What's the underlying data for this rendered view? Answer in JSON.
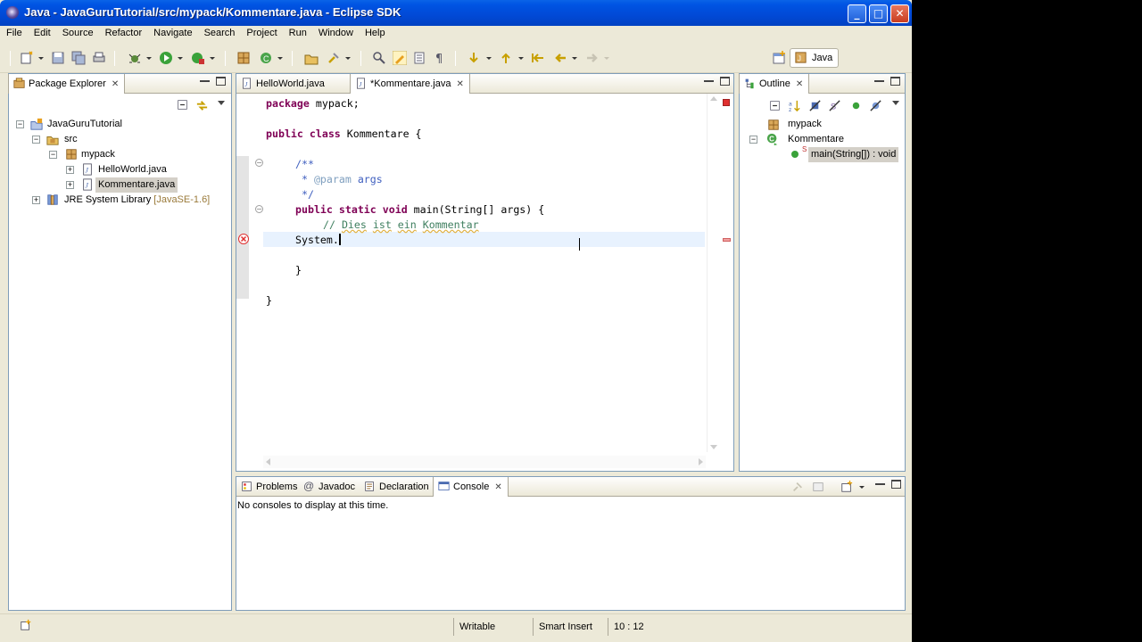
{
  "window": {
    "title": "Java - JavaGuruTutorial/src/mypack/Kommentare.java - Eclipse SDK",
    "controls": {
      "minimize": "_",
      "maximize": "□",
      "close": "✕"
    }
  },
  "menu": [
    "File",
    "Edit",
    "Source",
    "Refactor",
    "Navigate",
    "Search",
    "Project",
    "Run",
    "Window",
    "Help"
  ],
  "perspective": {
    "label": "Java"
  },
  "package_explorer": {
    "title": "Package Explorer",
    "tree": {
      "project": "JavaGuruTutorial",
      "src": "src",
      "package": "mypack",
      "file1": "HelloWorld.java",
      "file2": "Kommentare.java",
      "jre": "JRE System Library",
      "jre_version": "[JavaSE-1.6]"
    }
  },
  "editor": {
    "tabs": [
      "HelloWorld.java",
      "*Kommentare.java"
    ],
    "code": {
      "l1_kw": "package",
      "l1_rest": " mypack;",
      "l3_kw1": "public",
      "l3_kw2": "class",
      "l3_rest": " Kommentare {",
      "l5": "/**",
      "l6_pre": " * ",
      "l6_tag": "@param",
      "l6_rest": " args",
      "l7": " */",
      "l8_kw1": "public",
      "l8_kw2": "static",
      "l8_kw3": "void",
      "l8_rest": " main(String[] args) {",
      "l9_pre": "// ",
      "l9_a": "Dies",
      "l9_b": " ",
      "l9_c": "ist",
      "l9_d": " ",
      "l9_e": "ein",
      "l9_f": " ",
      "l9_g": "Kommentar",
      "l10": "System.",
      "l12": "}",
      "l14": "}"
    }
  },
  "outline": {
    "title": "Outline",
    "items": {
      "package": "mypack",
      "class": "Kommentare",
      "method": "main(String[]) : void",
      "method_modifier": "S"
    }
  },
  "bottom": {
    "tabs": [
      "Problems",
      "Javadoc",
      "Declaration",
      "Console"
    ],
    "message": "No consoles to display at this time."
  },
  "status": {
    "writable": "Writable",
    "insert_mode": "Smart Insert",
    "position": "10 : 12"
  },
  "colors": {
    "titlebar": "#0054e3",
    "chrome": "#ece9d8",
    "keyword": "#7f0055",
    "comment": "#3f7f5f",
    "javadoc": "#3f5fbf",
    "error": "#e03030"
  }
}
